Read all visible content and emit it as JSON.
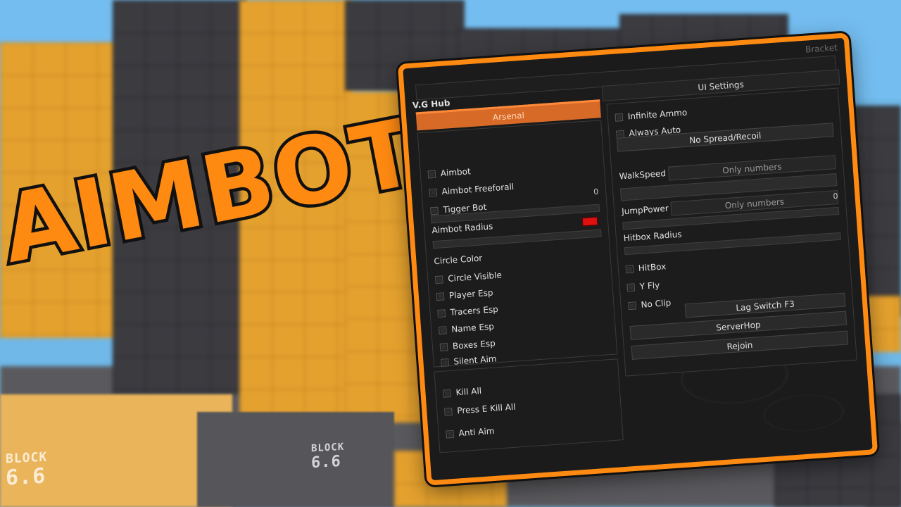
{
  "thumbnail_title": "AIMBOT",
  "background_labels": [
    "BLOCK",
    "6.6",
    "BLOCK",
    "6.6"
  ],
  "colors": {
    "accent": "#ff8a12",
    "tab_active": "#d86a27",
    "circle_color": "#e01010"
  },
  "window": {
    "title": "V.G Hub",
    "brand": "Bracket",
    "tabs": [
      {
        "label": "Arsenal",
        "active": true
      },
      {
        "label": "UI Settings",
        "active": false
      }
    ]
  },
  "left_panel": {
    "toggles": [
      "Aimbot",
      "Aimbot Freeforall",
      "Tigger Bot"
    ],
    "aimbot_radius": {
      "label": "Aimbot Radius",
      "value": "0"
    },
    "circle_color_label": "Circle Color",
    "toggles2": [
      "Circle Visible",
      "Player Esp",
      "Tracers Esp",
      "Name Esp",
      "Boxes Esp",
      "Silent Aim"
    ]
  },
  "left_panel2": {
    "toggles": [
      "Kill All",
      "Press E Kill All",
      "Anti Aim"
    ]
  },
  "right_panel": {
    "toggles": [
      "Infinite Ammo",
      "Always Auto"
    ],
    "no_spread_button": "No Spread/Recoil",
    "walkspeed": {
      "label": "WalkSpeed",
      "placeholder": "Only numbers"
    },
    "jumppower": {
      "label": "JumpPower",
      "placeholder": "Only numbers"
    },
    "hitbox_radius": {
      "label": "Hitbox Radius",
      "value": "0"
    },
    "toggles2": [
      "HitBox",
      "Y Fly",
      "No Clip"
    ],
    "buttons": [
      "Lag Switch F3",
      "ServerHop",
      "Rejoin"
    ]
  }
}
